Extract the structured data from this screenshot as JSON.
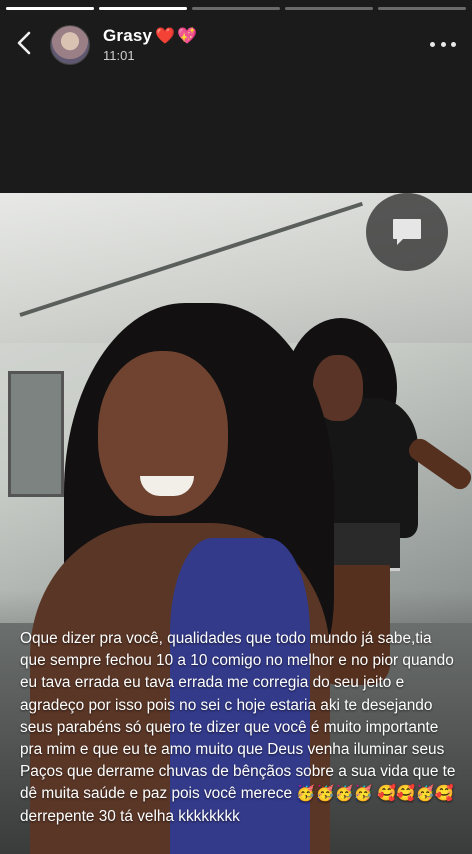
{
  "story": {
    "progress": [
      1,
      1,
      0,
      0,
      0
    ],
    "user": {
      "name": "Grasy",
      "hearts": [
        "❤️",
        "💖"
      ],
      "time": "11:01"
    },
    "icons": {
      "back": "chevron-left-icon",
      "more": "more-horizontal-icon",
      "reply": "comment-icon"
    },
    "caption": "Oque dizer pra você, qualidades que todo mundo já sabe,tia que sempre fechou 10 a 10 comigo no melhor e no pior quando eu tava errada eu tava errada me corregia do seu jeito e agradeço por isso pois no sei c hoje estaria aki te desejando seus parabéns só quero te dizer que você é muito importante pra mim e que eu te amo muito que Deus venha iluminar seus Paços que derrame chuvas de bênçãos sobre a sua vida que te dê muita saúde e paz pois você merece 🥳🥳🥳🥳 🥰🥰🥳🥰 derrepente 30 tá velha kkkkkkkk"
  }
}
